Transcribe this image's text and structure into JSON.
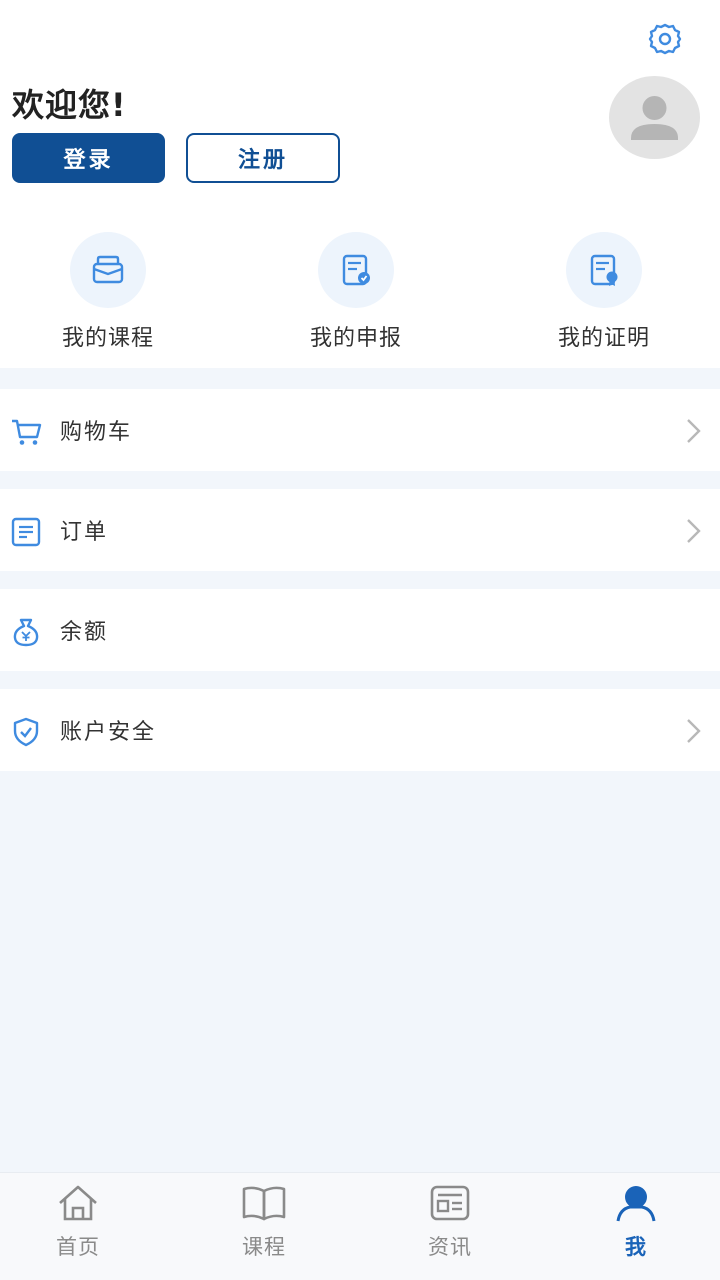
{
  "header": {
    "welcome": "欢迎您!",
    "login_label": "登录",
    "register_label": "注册"
  },
  "quick_links": [
    {
      "label": "我的课程",
      "icon": "course-icon"
    },
    {
      "label": "我的申报",
      "icon": "declaration-icon"
    },
    {
      "label": "我的证明",
      "icon": "certificate-icon"
    }
  ],
  "menu": [
    {
      "label": "购物车",
      "icon": "cart-icon",
      "has_arrow": true
    },
    {
      "label": "订单",
      "icon": "order-icon",
      "has_arrow": true
    },
    {
      "label": "余额",
      "icon": "balance-icon",
      "has_arrow": false
    },
    {
      "label": "账户安全",
      "icon": "shield-icon",
      "has_arrow": true
    }
  ],
  "tabs": [
    {
      "label": "首页",
      "icon": "home-icon",
      "active": false
    },
    {
      "label": "课程",
      "icon": "book-icon",
      "active": false
    },
    {
      "label": "资讯",
      "icon": "news-icon",
      "active": false
    },
    {
      "label": "我",
      "icon": "person-icon",
      "active": true
    }
  ],
  "colors": {
    "primary": "#104f94",
    "accent": "#1a63b8",
    "icon_blue": "#3f8be0",
    "page_bg": "#f2f6fb"
  }
}
